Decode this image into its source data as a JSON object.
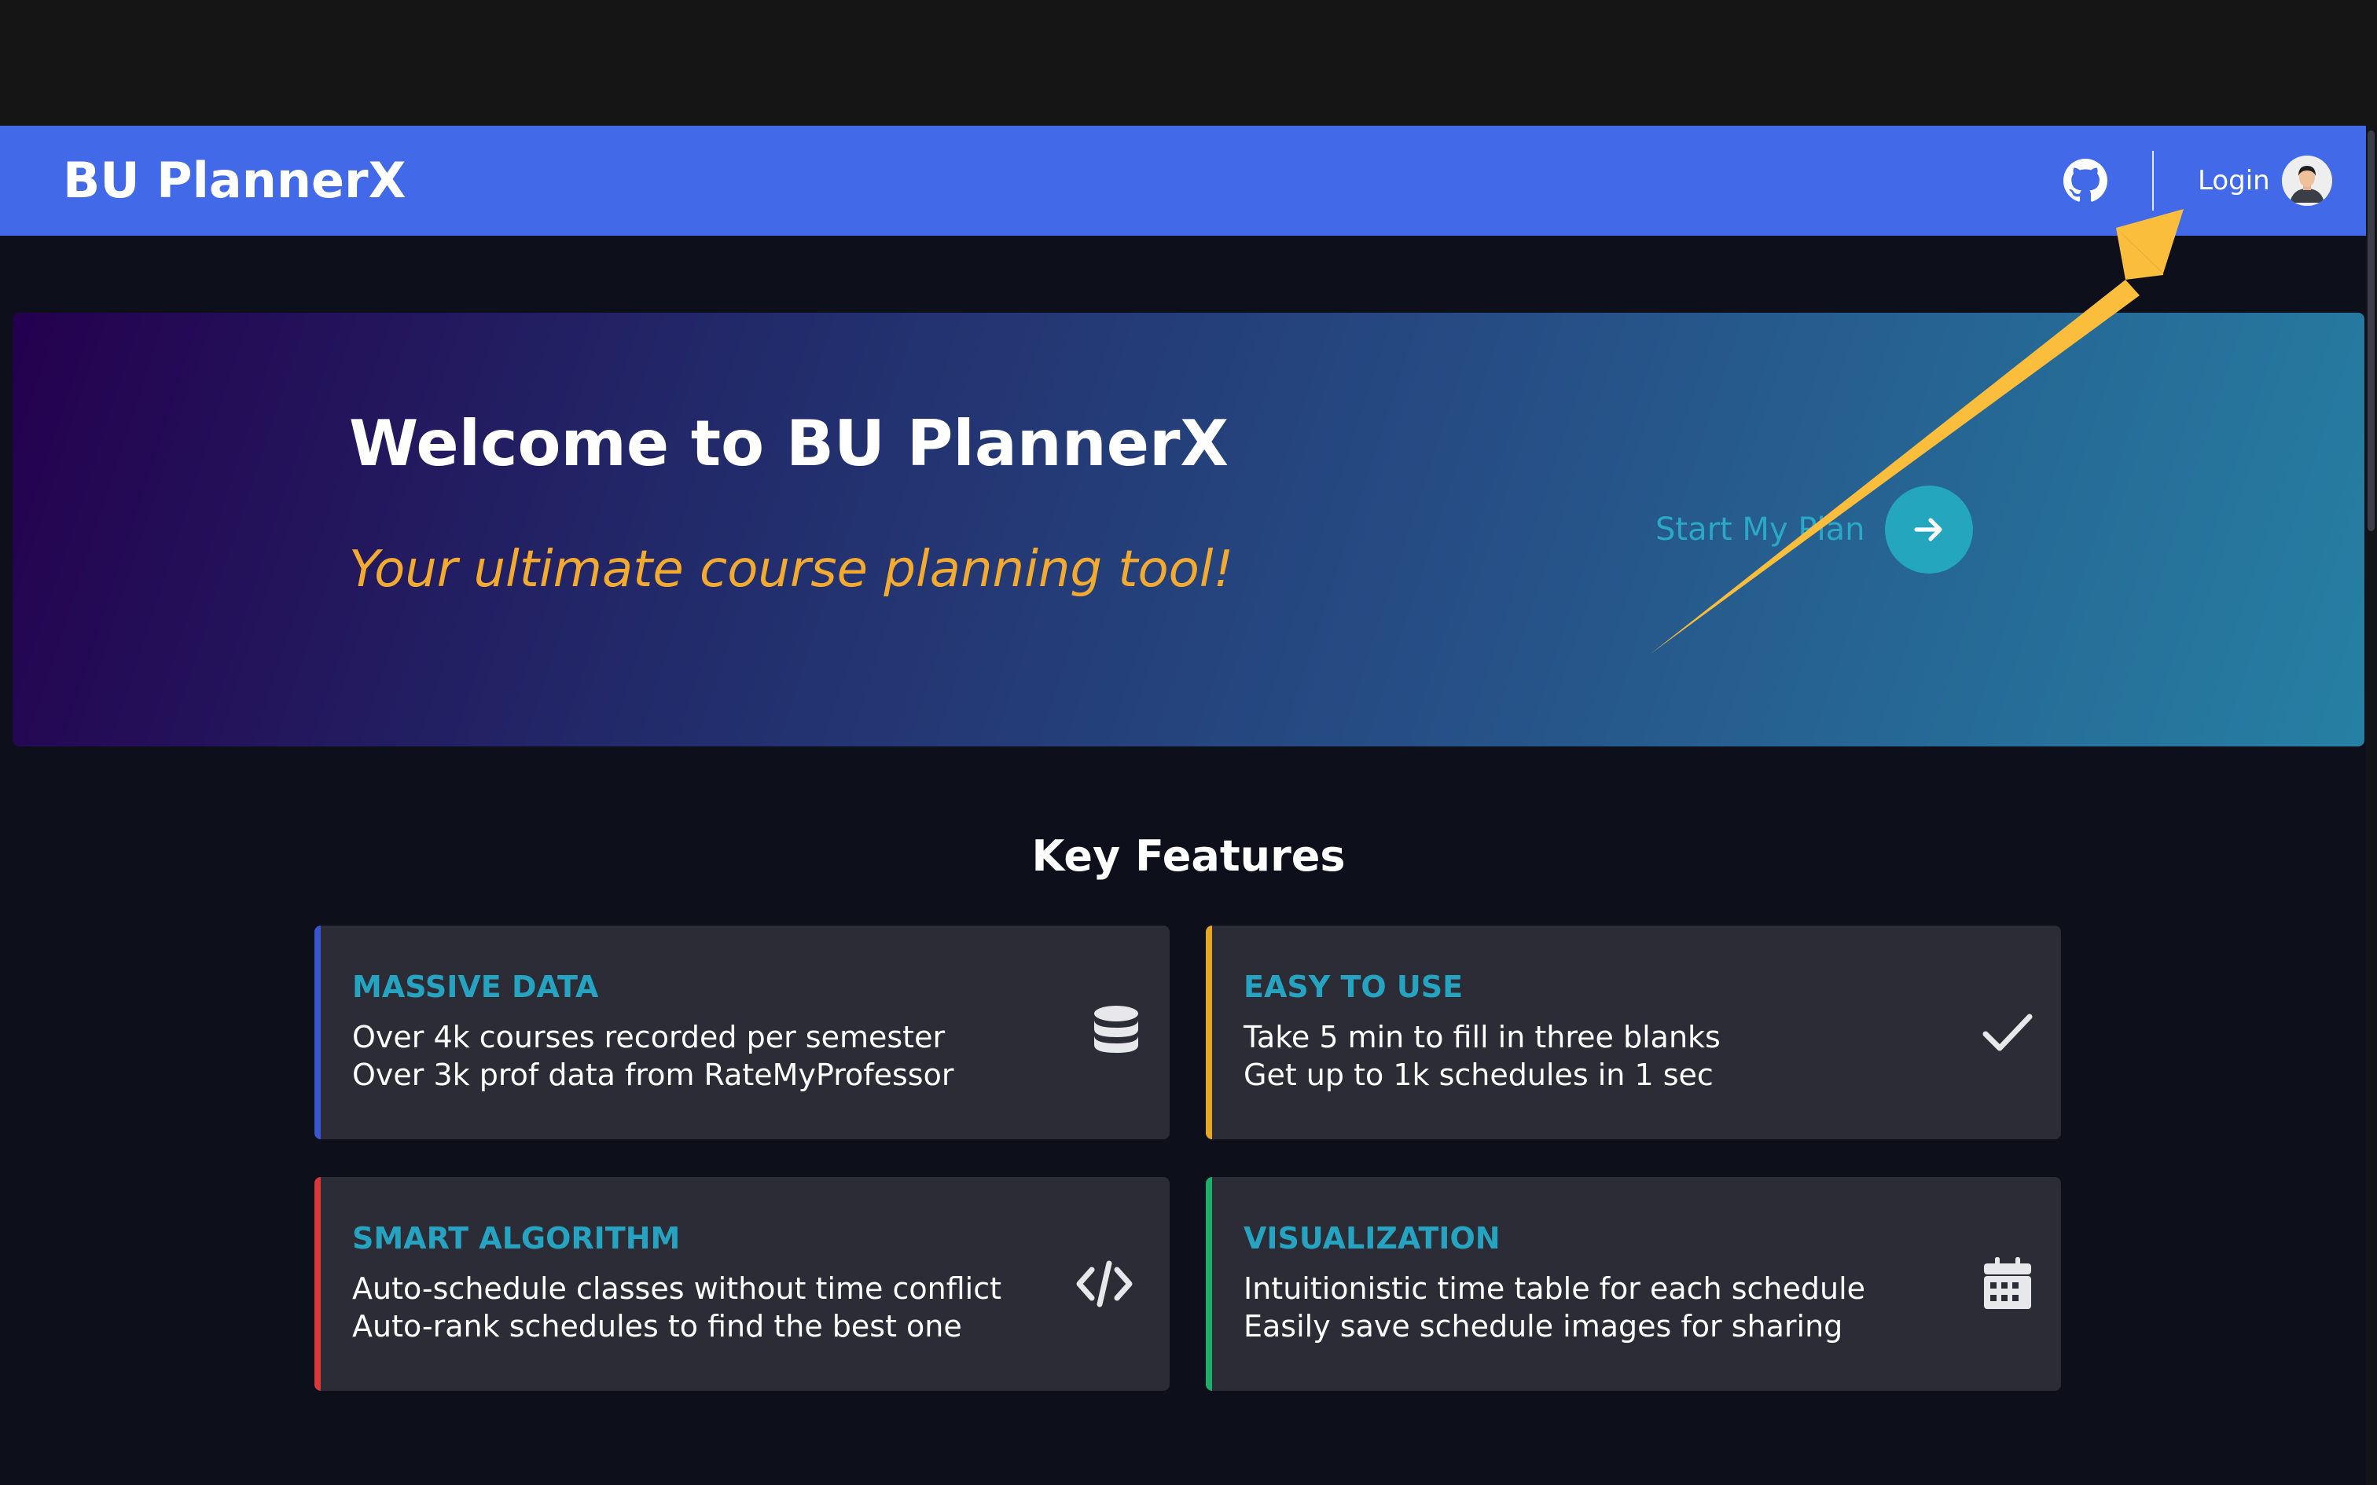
{
  "navbar": {
    "brand": "BU PlannerX",
    "login_label": "Login",
    "github_icon": "github-icon",
    "avatar_icon": "user-avatar",
    "background_color": "#4169e8"
  },
  "hero": {
    "title": "Welcome to BU PlannerX",
    "subtitle": "Your ultimate course planning tool!",
    "cta_label": "Start My Plan",
    "cta_icon": "arrow-right-icon",
    "subtitle_color": "#f2aa30",
    "cta_color": "#24a6bf"
  },
  "features": {
    "heading": "Key Features",
    "cards": [
      {
        "title": "MASSIVE DATA",
        "line1": "Over 4k courses recorded per semester",
        "line2": "Over 3k prof data from RateMyProfessor",
        "icon": "database-icon",
        "accent": "#3a55d0"
      },
      {
        "title": "EASY TO USE",
        "line1": "Take 5 min to fill in three blanks",
        "line2": "Get up to 1k schedules in 1 sec",
        "icon": "checkmark-icon",
        "accent": "#e6a822"
      },
      {
        "title": "SMART ALGORITHM",
        "line1": "Auto-schedule classes without time conflict",
        "line2": "Auto-rank schedules to find the best one",
        "icon": "code-icon",
        "accent": "#d83a3a"
      },
      {
        "title": "VISUALIZATION",
        "line1": "Intuitionistic time table for each schedule",
        "line2": "Easily save schedule images for sharing",
        "icon": "calendar-icon",
        "accent": "#1fae6a"
      }
    ]
  },
  "annotation": {
    "type": "arrow",
    "color": "#fbbd3c"
  }
}
